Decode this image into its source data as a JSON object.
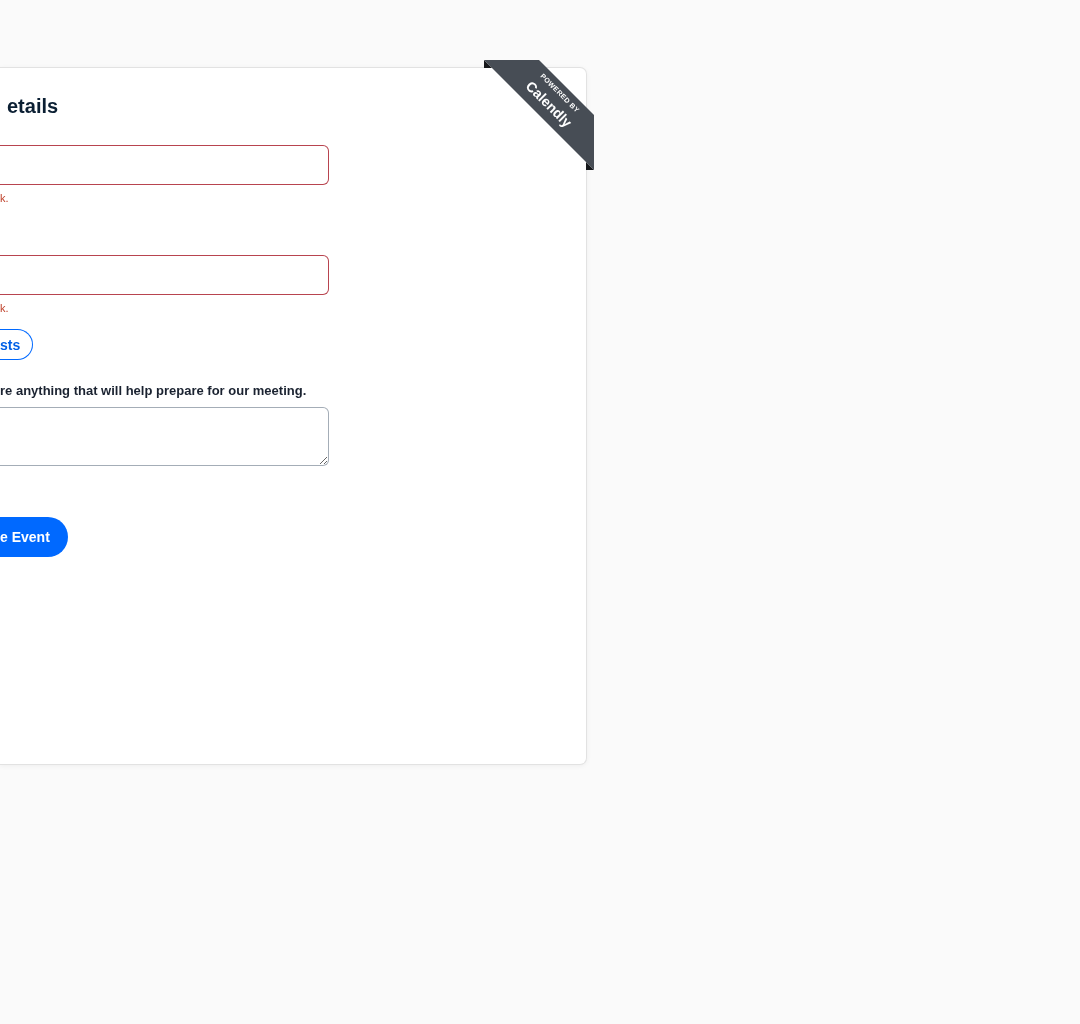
{
  "ribbon": {
    "line_1": "POWERED BY",
    "line_2": "Calendly"
  },
  "heading": "etails",
  "fields": [
    {
      "kind": "input",
      "invalid": true,
      "error": "k."
    },
    {
      "kind": "input",
      "invalid": true,
      "error": "k."
    }
  ],
  "secondary_button": {
    "label": "sts"
  },
  "notes_field": {
    "label": "re anything that will help prepare for our meeting."
  },
  "submit_button": {
    "label": "e Event"
  }
}
